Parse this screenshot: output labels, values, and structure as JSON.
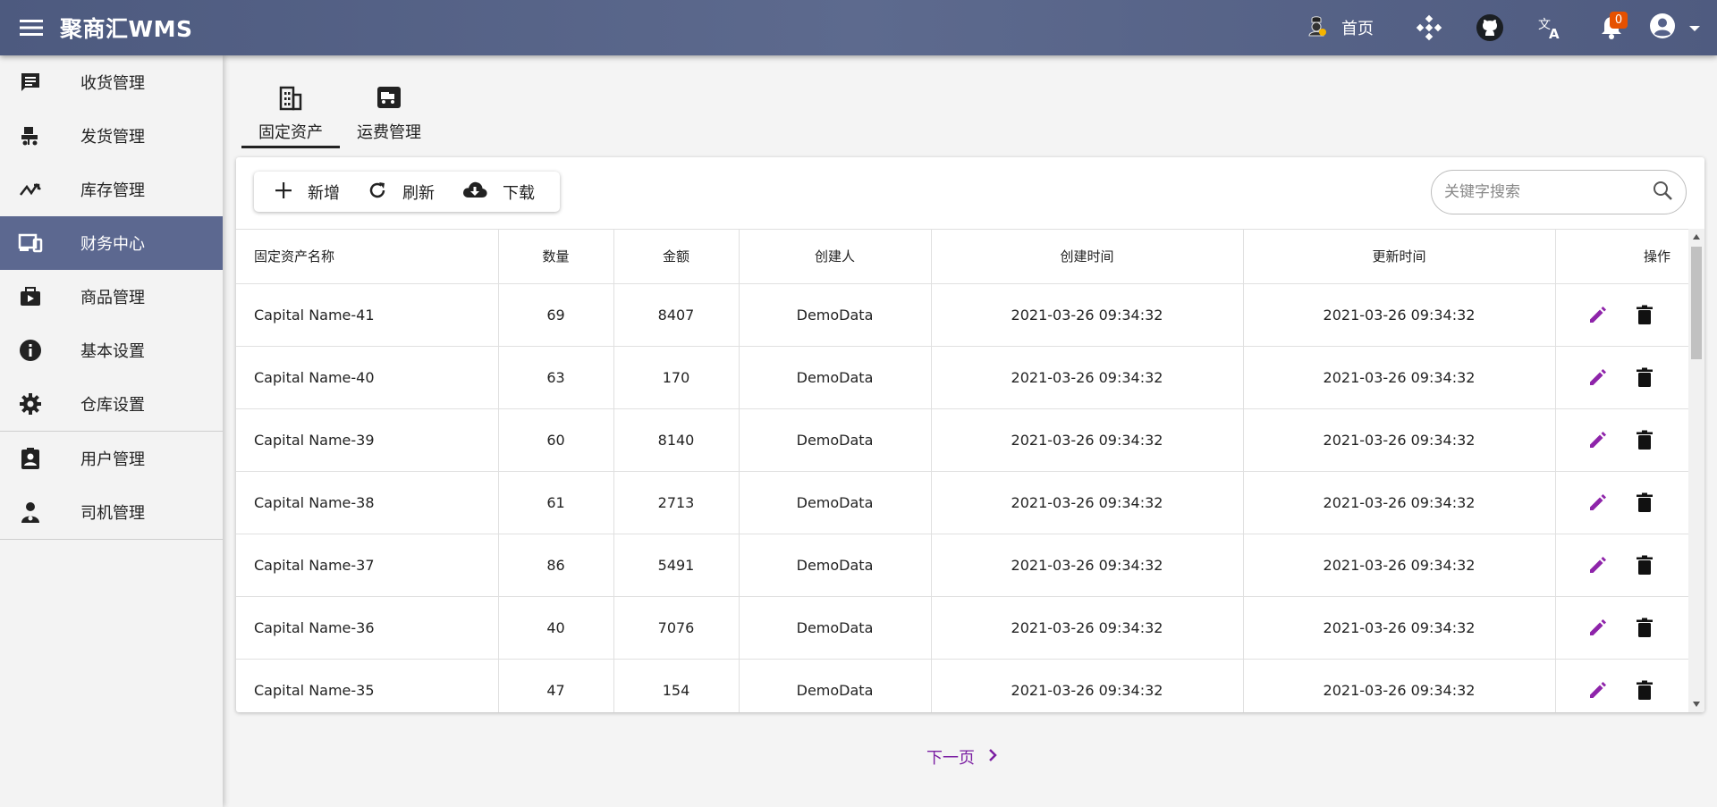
{
  "header": {
    "title": "聚商汇WMS",
    "home_label": "首页",
    "notification_count": "0",
    "icons": [
      "menu-icon",
      "home-guard-icon",
      "network-icon",
      "github-icon",
      "translate-icon",
      "bell-icon",
      "account-icon",
      "chevron-down-icon"
    ]
  },
  "sidebar": {
    "items": [
      {
        "label": "收货管理",
        "icon": "receipt-icon"
      },
      {
        "label": "发货管理",
        "icon": "truck-icon"
      },
      {
        "label": "库存管理",
        "icon": "trending-icon"
      },
      {
        "label": "财务中心",
        "icon": "devices-icon"
      },
      {
        "label": "商品管理",
        "icon": "briefcase-play-icon"
      },
      {
        "label": "基本设置",
        "icon": "info-icon"
      },
      {
        "label": "仓库设置",
        "icon": "gear-icon"
      },
      {
        "label": "用户管理",
        "icon": "badge-icon"
      },
      {
        "label": "司机管理",
        "icon": "driver-icon"
      }
    ],
    "active_label": "财务中心"
  },
  "tabs": [
    {
      "label": "固定资产",
      "icon": "building-icon"
    },
    {
      "label": "运费管理",
      "icon": "shipping-icon"
    }
  ],
  "toolbar": {
    "add_label": "新增",
    "refresh_label": "刷新",
    "download_label": "下载"
  },
  "search": {
    "placeholder": "关键字搜索",
    "value": ""
  },
  "table": {
    "columns": [
      "固定资产名称",
      "数量",
      "金额",
      "创建人",
      "创建时间",
      "更新时间",
      "操作"
    ],
    "rows": [
      {
        "name": "Capital Name-41",
        "qty": "69",
        "amount": "8407",
        "creator": "DemoData",
        "created": "2021-03-26 09:34:32",
        "updated": "2021-03-26 09:34:32"
      },
      {
        "name": "Capital Name-40",
        "qty": "63",
        "amount": "170",
        "creator": "DemoData",
        "created": "2021-03-26 09:34:32",
        "updated": "2021-03-26 09:34:32"
      },
      {
        "name": "Capital Name-39",
        "qty": "60",
        "amount": "8140",
        "creator": "DemoData",
        "created": "2021-03-26 09:34:32",
        "updated": "2021-03-26 09:34:32"
      },
      {
        "name": "Capital Name-38",
        "qty": "61",
        "amount": "2713",
        "creator": "DemoData",
        "created": "2021-03-26 09:34:32",
        "updated": "2021-03-26 09:34:32"
      },
      {
        "name": "Capital Name-37",
        "qty": "86",
        "amount": "5491",
        "creator": "DemoData",
        "created": "2021-03-26 09:34:32",
        "updated": "2021-03-26 09:34:32"
      },
      {
        "name": "Capital Name-36",
        "qty": "40",
        "amount": "7076",
        "creator": "DemoData",
        "created": "2021-03-26 09:34:32",
        "updated": "2021-03-26 09:34:32"
      },
      {
        "name": "Capital Name-35",
        "qty": "47",
        "amount": "154",
        "creator": "DemoData",
        "created": "2021-03-26 09:34:32",
        "updated": "2021-03-26 09:34:32"
      }
    ]
  },
  "pager": {
    "next_label": "下一页"
  },
  "colors": {
    "header_bg": "#56628a",
    "active_nav_bg": "#5c6890",
    "edit_icon": "#8e24aa",
    "pager_link": "#7b1fa2",
    "badge": "#e65100"
  }
}
